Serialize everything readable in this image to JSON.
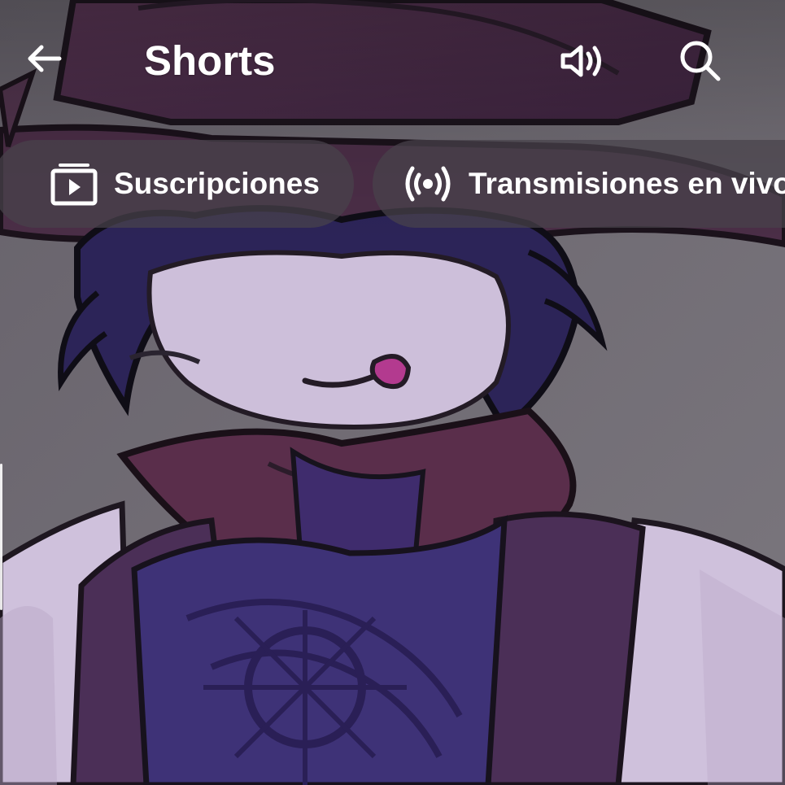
{
  "header": {
    "title": "Shorts",
    "back_icon": "arrow-left-icon",
    "sound_icon": "volume-icon",
    "search_icon": "search-icon"
  },
  "chips": [
    {
      "label": "Suscripciones",
      "icon": "subscriptions-icon"
    },
    {
      "label": "Transmisiones en vivo",
      "icon": "live-broadcast-icon"
    }
  ],
  "colors": {
    "text": "#ffffff",
    "chip_background": "#48424b",
    "backdrop": "#6f6a73",
    "hat": "#4a2b45",
    "hair": "#2b2458",
    "skin": "#c9b9d6",
    "scarf": "#5a2d4a",
    "tongue": "#b33a8f"
  }
}
